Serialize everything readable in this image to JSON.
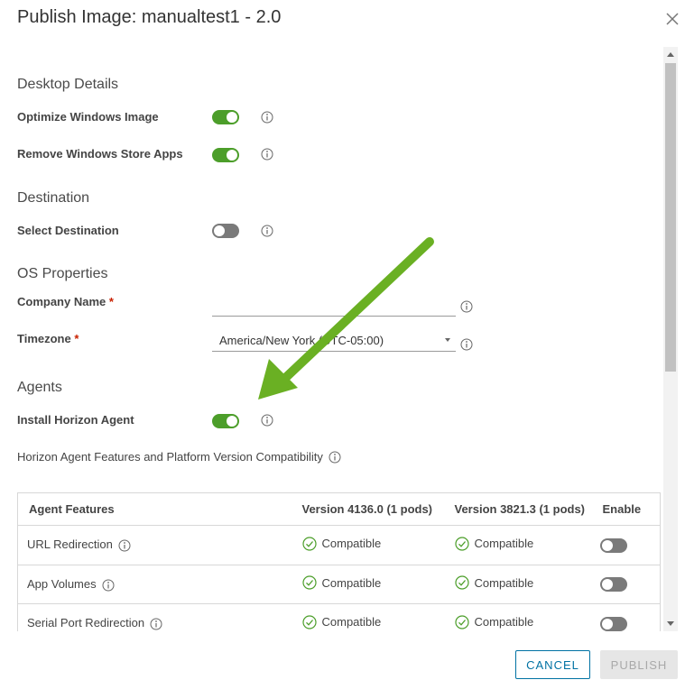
{
  "dialog": {
    "title": "Publish Image: manualtest1 - 2.0",
    "icons": {
      "close": "close-icon",
      "info": "info-icon",
      "check": "check-circle-icon"
    },
    "colors": {
      "toggle_on": "#4c9e2a",
      "toggle_off": "#7a7a7a",
      "accent": "#0072a3",
      "required": "#c92100",
      "annotation_arrow": "#6ab023"
    }
  },
  "desktop_details": {
    "title": "Desktop Details",
    "optimize_label": "Optimize Windows Image",
    "optimize_on": true,
    "remove_store_label": "Remove Windows Store Apps",
    "remove_store_on": true
  },
  "destination": {
    "title": "Destination",
    "select_label": "Select Destination",
    "select_on": false
  },
  "os_properties": {
    "title": "OS Properties",
    "company_label": "Company Name",
    "company_value": "",
    "timezone_label": "Timezone",
    "timezone_value": "America/New York (UTC-05:00)",
    "required_mark": "*"
  },
  "agents": {
    "title": "Agents",
    "install_label": "Install Horizon Agent",
    "install_on": true,
    "compat_text": "Horizon Agent Features and Platform Version Compatibility"
  },
  "table": {
    "headers": [
      "Agent Features",
      "Version 4136.0 (1 pods)",
      "Version 3821.3 (1 pods)",
      "Enable"
    ],
    "rows": [
      {
        "feature": "URL Redirection",
        "v1": "Compatible",
        "v2": "Compatible",
        "enabled": false
      },
      {
        "feature": "App Volumes",
        "v1": "Compatible",
        "v2": "Compatible",
        "enabled": false
      },
      {
        "feature": "Serial Port Redirection",
        "v1": "Compatible",
        "v2": "Compatible",
        "enabled": false
      }
    ]
  },
  "footer": {
    "cancel_label": "CANCEL",
    "publish_label": "PUBLISH",
    "publish_enabled": false
  }
}
